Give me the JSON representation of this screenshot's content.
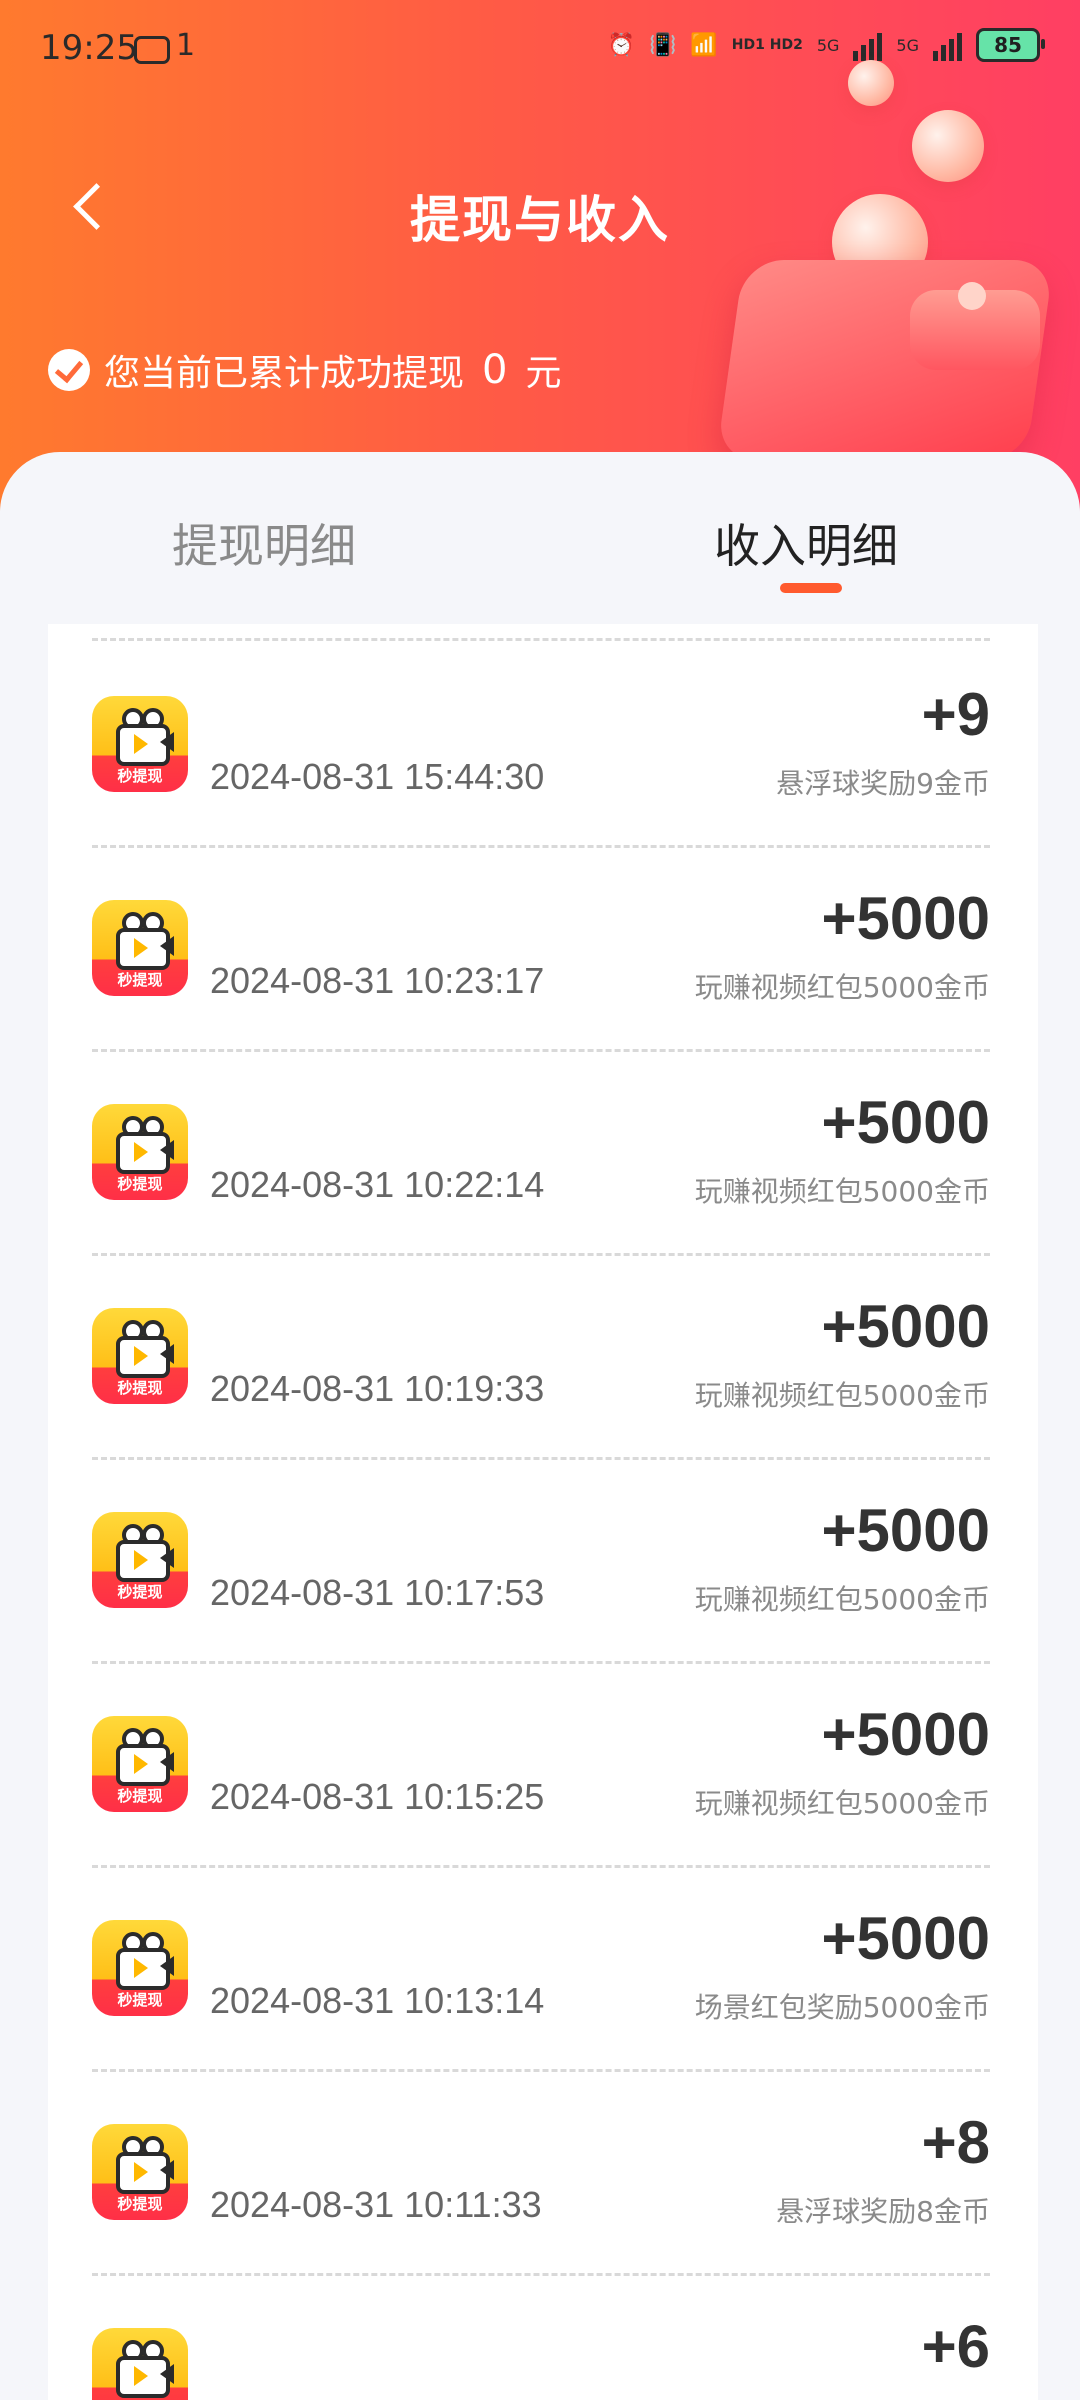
{
  "status_bar": {
    "time": "19:25",
    "message_count": "1",
    "network_1": "5G",
    "network_2": "5G",
    "hd_label": "HD1 HD2",
    "battery": "85",
    "icons": [
      "alarm-icon",
      "vibrate-icon",
      "wifi-icon",
      "hd-icon",
      "signal-icon",
      "battery-icon"
    ]
  },
  "header": {
    "title": "提现与收入",
    "summary_prefix": "您当前已累计成功提现",
    "summary_amount": "0",
    "summary_unit": "元",
    "colors": {
      "gradient_start": "#ff7a2e",
      "gradient_end": "#ff3f63"
    }
  },
  "tabs": [
    {
      "label": "提现明细",
      "active": false
    },
    {
      "label": "收入明细",
      "active": true
    }
  ],
  "accent_color": "#ff5a2e",
  "records": [
    {
      "app_title": "",
      "app_badge": "秒提现",
      "time": "2024-08-31 15:44:30",
      "amount": "+9",
      "desc": "悬浮球奖励9金币"
    },
    {
      "app_title": "",
      "app_badge": "秒提现",
      "time": "2024-08-31 10:23:17",
      "amount": "+5000",
      "desc": "玩赚视频红包5000金币"
    },
    {
      "app_title": "",
      "app_badge": "秒提现",
      "time": "2024-08-31 10:22:14",
      "amount": "+5000",
      "desc": "玩赚视频红包5000金币"
    },
    {
      "app_title": "",
      "app_badge": "秒提现",
      "time": "2024-08-31 10:19:33",
      "amount": "+5000",
      "desc": "玩赚视频红包5000金币"
    },
    {
      "app_title": "",
      "app_badge": "秒提现",
      "time": "2024-08-31 10:17:53",
      "amount": "+5000",
      "desc": "玩赚视频红包5000金币"
    },
    {
      "app_title": "",
      "app_badge": "秒提现",
      "time": "2024-08-31 10:15:25",
      "amount": "+5000",
      "desc": "玩赚视频红包5000金币"
    },
    {
      "app_title": "",
      "app_badge": "秒提现",
      "time": "2024-08-31 10:13:14",
      "amount": "+5000",
      "desc": "场景红包奖励5000金币"
    },
    {
      "app_title": "",
      "app_badge": "秒提现",
      "time": "2024-08-31 10:11:33",
      "amount": "+8",
      "desc": "悬浮球奖励8金币"
    },
    {
      "app_title": "",
      "app_badge": "秒提现",
      "time": "",
      "amount": "+6",
      "desc": ""
    }
  ]
}
